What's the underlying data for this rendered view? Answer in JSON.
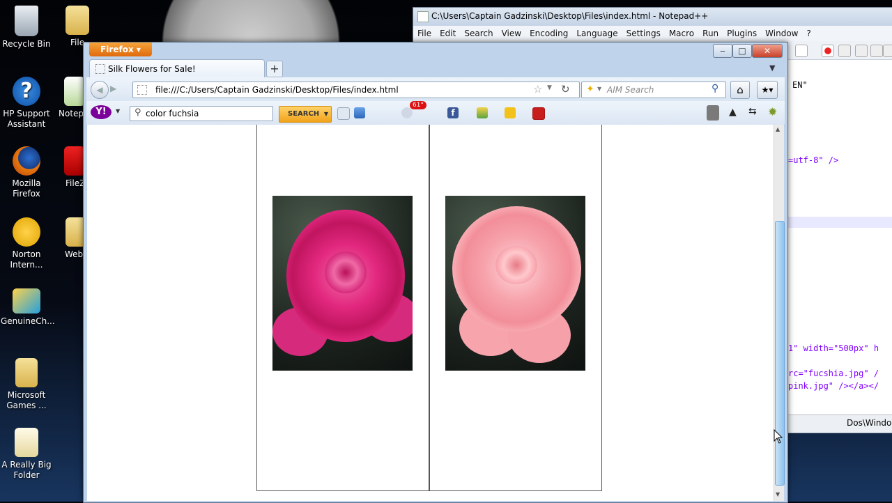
{
  "desktop": {
    "icons": [
      {
        "label": "Recycle Bin"
      },
      {
        "label": "File"
      },
      {
        "label": "HP Support Assistant"
      },
      {
        "label": "Notep"
      },
      {
        "label": "Mozilla Firefox"
      },
      {
        "label": "FileZ"
      },
      {
        "label": "Norton Intern..."
      },
      {
        "label": "Web"
      },
      {
        "label": "GenuineCh..."
      },
      {
        "label": "Microsoft Games ..."
      },
      {
        "label": "A Really Big Folder"
      }
    ]
  },
  "notepad": {
    "title": "C:\\Users\\Captain Gadzinski\\Desktop\\Files\\index.html - Notepad++",
    "menu": [
      "File",
      "Edit",
      "Search",
      "View",
      "Encoding",
      "Language",
      "Settings",
      "Macro",
      "Run",
      "Plugins",
      "Window",
      "?"
    ],
    "code_lines": [
      "EN\"",
      "=utf-8\" />",
      "1\" width=\"500px\" h",
      "rc=\"fucshia.jpg\" /",
      "pink.jpg\" /></a></"
    ],
    "status": "Dos\\Window"
  },
  "firefox": {
    "menu_button": "Firefox",
    "tab_title": "Silk Flowers for Sale!",
    "new_tab": "+",
    "url": "file:///C:/Users/Captain Gadzinski/Desktop/Files/index.html",
    "search_placeholder": "AIM Search",
    "yahoo_query": "color fuchsia",
    "search_button": "SEARCH",
    "weather_badge": "61°",
    "colors": {
      "accent_orange": "#e8780f",
      "yahoo_purple": "#7b0099"
    }
  },
  "page": {
    "images": [
      {
        "name": "fuchsia rose",
        "color": "#e2287f"
      },
      {
        "name": "pink rose",
        "color": "#f7a4ad"
      }
    ]
  }
}
